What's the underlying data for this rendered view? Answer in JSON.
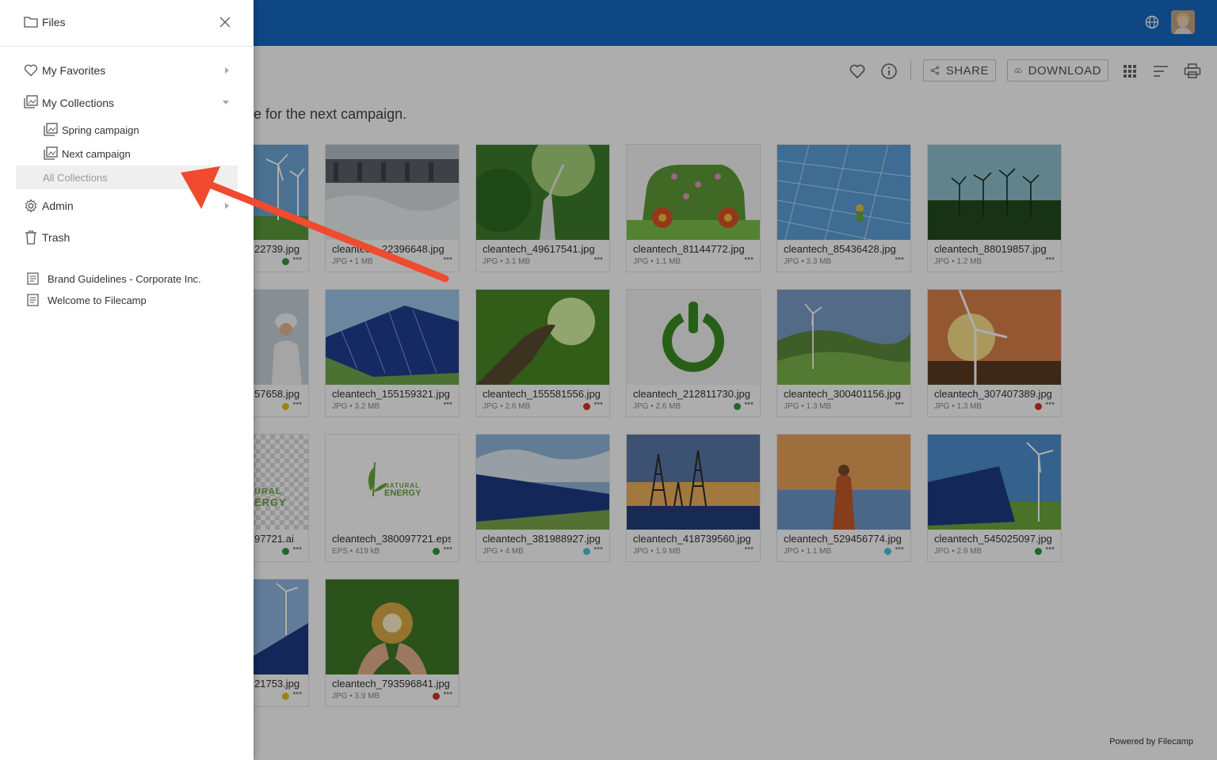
{
  "sidebar": {
    "title": "Files",
    "items": [
      {
        "label": "My Favorites"
      },
      {
        "label": "My Collections"
      },
      {
        "label": "Spring campaign"
      },
      {
        "label": "Next campaign"
      },
      {
        "label": "All Collections"
      },
      {
        "label": "Admin"
      },
      {
        "label": "Trash"
      }
    ],
    "documents": [
      {
        "label": "Brand Guidelines - Corporate Inc."
      },
      {
        "label": "Welcome to Filecamp"
      }
    ]
  },
  "toolbar": {
    "share_label": "SHARE",
    "download_label": "DOWNLOAD"
  },
  "content": {
    "description_visible": "e for the next campaign.",
    "files": [
      {
        "name": "22739.jpg",
        "meta": "",
        "status": "green"
      },
      {
        "name": "cleantech_22396648.jpg",
        "meta": "JPG • 1 MB",
        "status": ""
      },
      {
        "name": "cleantech_49617541.jpg",
        "meta": "JPG • 3.1 MB",
        "status": ""
      },
      {
        "name": "cleantech_81144772.jpg",
        "meta": "JPG • 1.1 MB",
        "status": ""
      },
      {
        "name": "cleantech_85436428.jpg",
        "meta": "JPG • 3.3 MB",
        "status": ""
      },
      {
        "name": "cleantech_88019857.jpg",
        "meta": "JPG • 1.2 MB",
        "status": ""
      },
      {
        "name": "57658.jpg",
        "meta": "",
        "status": "yellow"
      },
      {
        "name": "cleantech_155159321.jpg",
        "meta": "JPG • 3.2 MB",
        "status": ""
      },
      {
        "name": "cleantech_155581556.jpg",
        "meta": "JPG • 2.6 MB",
        "status": "red"
      },
      {
        "name": "cleantech_212811730.jpg",
        "meta": "JPG • 2.6 MB",
        "status": "green"
      },
      {
        "name": "cleantech_300401156.jpg",
        "meta": "JPG • 1.3 MB",
        "status": ""
      },
      {
        "name": "cleantech_307407389.jpg",
        "meta": "JPG • 1.3 MB",
        "status": "red"
      },
      {
        "name": "97721.ai",
        "meta": "",
        "status": "green"
      },
      {
        "name": "cleantech_380097721.eps",
        "meta": "EPS • 419 kB",
        "status": "green"
      },
      {
        "name": "cleantech_381988927.jpg",
        "meta": "JPG • 4 MB",
        "status": "cyan"
      },
      {
        "name": "cleantech_418739560.jpg",
        "meta": "JPG • 1.9 MB",
        "status": ""
      },
      {
        "name": "cleantech_529456774.jpg",
        "meta": "JPG • 1.1 MB",
        "status": "cyan"
      },
      {
        "name": "cleantech_545025097.jpg",
        "meta": "JPG • 2.9 MB",
        "status": "green"
      },
      {
        "name": "21753.jpg",
        "meta": "",
        "status": "yellow"
      },
      {
        "name": "cleantech_793596841.jpg",
        "meta": "JPG • 3.9 MB",
        "status": "red"
      }
    ],
    "logo_text_1": "NATURAL",
    "logo_text_2": "ENERGY",
    "logo_partial_1": "URAL",
    "logo_partial_2": "ERGY"
  },
  "footer": {
    "powered_by": "Powered by Filecamp"
  },
  "colors": {
    "brand_blue": "#1769c4",
    "arrow_red": "#f04a2f",
    "status_green": "#2e9b3a",
    "status_yellow": "#e8c21a",
    "status_red": "#d7301f",
    "status_cyan": "#4fc3d9"
  },
  "icons": {
    "files": "folder-icon",
    "close": "close-icon",
    "favorites": "heart-icon",
    "collections": "collection-icon",
    "admin": "gear-icon",
    "trash": "trash-icon",
    "document": "document-icon"
  }
}
